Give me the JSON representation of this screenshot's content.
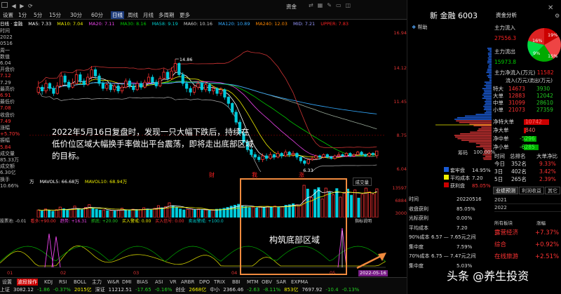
{
  "top_tabs": [
    "设置",
    "1分",
    "5分",
    "15分",
    "30分",
    "60分",
    "日线",
    "周线",
    "月线",
    "多周期",
    "更多"
  ],
  "selected_top_tab": "日线",
  "side_tool": "资金",
  "ma_line": {
    "title": "日线 · 金融",
    "ma5": "MA5: 7.33",
    "ma10": "MA10: 7.04",
    "ma20": "MA20: 7.11",
    "ma30": "MA30: 8.16",
    "ma58": "MA58: 9.19",
    "ma60": "MA60: 10.16",
    "ma120": "MA120: 10.89",
    "ma240": "MA240: 12.03",
    "mid": "MID: 7.21",
    "upper": "UPPER: 7.83"
  },
  "left_info": [
    {
      "label": "时间",
      "value": "2022"
    },
    {
      "label": "",
      "value": "0516"
    },
    {
      "label": "",
      "value": "周一"
    },
    {
      "label": "数值",
      "value": "6.04"
    },
    {
      "label": "开盘价",
      "value": "7.12"
    },
    {
      "label": "",
      "value": "7.29"
    },
    {
      "label": "最高价",
      "value": "6.91"
    },
    {
      "label": "最低价",
      "value": "7.08"
    },
    {
      "label": "收盘价",
      "value": "7.49"
    },
    {
      "label": "涨幅",
      "value": "+5.70%"
    },
    {
      "label": "振幅",
      "value": "5.84"
    },
    {
      "label": "成交量",
      "value": "85.33万"
    },
    {
      "label": "成交额",
      "value": "6.30亿"
    },
    {
      "label": "换手",
      "value": "10.66%"
    }
  ],
  "price_axis": [
    "16.94",
    "14.12",
    "11.45",
    "8.75",
    "6.04"
  ],
  "price_high_label": "14.86",
  "price_low_label": "6.33",
  "main_event_markers": [
    "财",
    "我",
    "涨"
  ],
  "annotation": "2022年5月16日复盘时，发现一只大幅下跌后，持续在低价位区域大幅换手率做出平台震荡，即将走出底部区域的目标。",
  "annotation_box2": "构筑底部区域",
  "date_arrow_label": "2022-05-16",
  "vol_header": {
    "unit": "万",
    "mavol5": "MAVOL5: 66.68万",
    "mavol10": "MAVOL10: 68.94万",
    "right_label": "成交量"
  },
  "vol_axis": [
    "13597",
    "6884",
    "3000"
  ],
  "indicator_header": [
    "股票池: -0.01",
    "看多:+90.00",
    "趋势: +16.31",
    "抓底: +20.00",
    "买入警戒: 0.00",
    "买入信号: 0.00",
    "卖出警戒: +100.0"
  ],
  "indicator_right": "指标说明",
  "x_dates": [
    "01",
    "02",
    "03",
    "04",
    "05"
  ],
  "bottom_tabs": [
    "设置",
    "波段操作",
    "KDJ",
    "RSI",
    "BOLL",
    "主力",
    "W&R",
    "DMI",
    "BIAS",
    "ASI",
    "VR",
    "ARBR",
    "DPO",
    "TRIX",
    "BBI",
    "MTM",
    "OBV",
    "SAR",
    "EXPMA"
  ],
  "selected_bottom_tab": "波段操作",
  "bottom_index": [
    "上证",
    "3082.12",
    "-1.86",
    "-0.37%",
    "2015亿",
    "深证",
    "11212.51",
    "-17.65",
    "-0.16%",
    "创业",
    "2668亿",
    "中小",
    "2366.46",
    "-2.63",
    "-8.11%",
    "853亿",
    "7697.92",
    "-10.4",
    "-0.13%"
  ],
  "right_panel": {
    "stock_title": "新",
    "stock_code": "6003",
    "stock_suffix": "金融",
    "help": "帮助",
    "fund_tab": "资金分析",
    "main_inflow_label": "主力流入",
    "main_inflow_value": "27556.3",
    "main_outflow_label": "主力流出",
    "main_outflow_value": "15973.8",
    "pie_labels": [
      "19%",
      "16%",
      "15%",
      "9%"
    ],
    "net_inflow_label": "主力净流入(万元)",
    "net_inflow_value": "11582",
    "flow_header": "流入(万元)流出(万元)",
    "flows": [
      {
        "label": "特大",
        "in": "14673",
        "out": "3930"
      },
      {
        "label": "大单",
        "in": "12883",
        "out": "12042"
      },
      {
        "label": "中单",
        "in": "31099",
        "out": "28610"
      },
      {
        "label": "小单",
        "in": "21073",
        "out": "27359"
      }
    ],
    "net": [
      {
        "label": "净特大单",
        "value": "10742"
      },
      {
        "label": "净大单",
        "value": "840"
      },
      {
        "label": "净中单",
        "value": "-5296"
      },
      {
        "label": "净小单",
        "value": "-6285"
      }
    ],
    "chip_header": "筹码",
    "chip_pct": "100.00%",
    "stats_header": [
      "时间",
      "总排名",
      "大单净比"
    ],
    "stats": [
      {
        "t": "今日",
        "rank": "352名",
        "pct": "9.33%"
      },
      {
        "t": "3日",
        "rank": "402名",
        "pct": "3.42%"
      },
      {
        "t": "5日",
        "rank": "265名",
        "pct": "2.39%"
      }
    ],
    "chip_legend": [
      {
        "label": "套牢盘",
        "value": "14.95%",
        "color": "#1a5bd6"
      },
      {
        "label": "平均成本",
        "value": "7.20",
        "color": "#ee0"
      },
      {
        "label": "获利盘",
        "value": "85.05%",
        "color": "#c00"
      }
    ],
    "f10_tabs": [
      "业绩预测",
      "利润收益",
      "其它"
    ],
    "f10_rows": [
      [
        "2021",
        ""
      ],
      [
        "2022",
        ""
      ]
    ],
    "cost_rows": [
      {
        "label": "时间",
        "value": "20220516"
      },
      {
        "label": "收盘获利",
        "value": "85.05%"
      },
      {
        "label": "光标获利",
        "value": "0.00%"
      },
      {
        "label": "平均成本",
        "value": "7.20"
      },
      {
        "label": "90%成本",
        "value": "6.57 — 7.65元之间"
      },
      {
        "label": "集中度",
        "value": "7.59%"
      },
      {
        "label": "70%成本",
        "value": "6.75 — 7.47元之间"
      },
      {
        "label": "集中度",
        "value": "5.03%"
      }
    ],
    "sector_header": [
      "所有板块",
      "涨幅"
    ],
    "sectors": [
      {
        "name": "露营经济",
        "chg": "+7.37%"
      },
      {
        "name": "综合",
        "chg": "+0.92%"
      },
      {
        "name": "在线旅游",
        "chg": "+2.51%"
      }
    ],
    "watermark": "头条 @养生投资"
  },
  "chart_data": {
    "type": "candlestick",
    "title": "",
    "y_range": [
      6.04,
      16.94
    ],
    "candles": [
      [
        12.2,
        12.6,
        13.1,
        12.0
      ],
      [
        12.6,
        12.3,
        12.8,
        12.0
      ],
      [
        12.3,
        12.9,
        13.2,
        12.1
      ],
      [
        12.9,
        12.5,
        13.0,
        12.3
      ],
      [
        12.5,
        12.1,
        12.7,
        11.9
      ],
      [
        12.1,
        12.7,
        13.0,
        12.0
      ],
      [
        12.7,
        13.5,
        13.8,
        12.6
      ],
      [
        13.5,
        13.0,
        13.7,
        12.8
      ],
      [
        13.0,
        12.6,
        13.2,
        12.4
      ],
      [
        12.6,
        12.9,
        13.3,
        12.5
      ],
      [
        12.9,
        13.6,
        14.0,
        12.8
      ],
      [
        13.6,
        13.1,
        13.8,
        12.9
      ],
      [
        13.1,
        12.8,
        13.3,
        12.6
      ],
      [
        12.8,
        13.4,
        13.7,
        12.7
      ],
      [
        13.4,
        14.0,
        14.3,
        13.2
      ],
      [
        14.0,
        13.5,
        14.2,
        13.3
      ],
      [
        13.5,
        12.9,
        13.7,
        12.7
      ],
      [
        12.9,
        12.5,
        13.1,
        12.3
      ],
      [
        12.5,
        12.8,
        13.0,
        12.3
      ],
      [
        12.8,
        12.4,
        13.0,
        12.2
      ],
      [
        12.4,
        12.7,
        12.9,
        12.2
      ],
      [
        12.7,
        12.3,
        12.9,
        12.1
      ],
      [
        12.3,
        12.6,
        12.8,
        12.1
      ],
      [
        12.6,
        13.1,
        13.3,
        12.5
      ],
      [
        13.1,
        12.7,
        13.3,
        12.5
      ],
      [
        12.7,
        12.4,
        12.9,
        12.2
      ],
      [
        12.4,
        12.9,
        13.1,
        12.3
      ],
      [
        12.9,
        12.6,
        13.1,
        12.4
      ],
      [
        12.6,
        13.0,
        13.2,
        12.5
      ],
      [
        13.0,
        13.4,
        13.7,
        12.9
      ],
      [
        13.4,
        13.0,
        13.6,
        12.8
      ],
      [
        13.0,
        12.7,
        13.2,
        12.5
      ],
      [
        12.7,
        13.3,
        13.5,
        12.6
      ],
      [
        13.3,
        13.8,
        14.1,
        13.2
      ],
      [
        13.8,
        13.3,
        14.0,
        13.1
      ],
      [
        13.3,
        13.9,
        14.2,
        13.2
      ],
      [
        13.9,
        14.5,
        14.86,
        13.8
      ],
      [
        14.5,
        13.6,
        14.6,
        13.4
      ],
      [
        13.6,
        12.9,
        13.8,
        12.7
      ],
      [
        12.9,
        12.5,
        13.1,
        12.2
      ],
      [
        12.5,
        12.2,
        12.7,
        11.9
      ],
      [
        12.2,
        12.6,
        12.8,
        12.0
      ],
      [
        12.6,
        12.9,
        13.1,
        12.4
      ],
      [
        12.9,
        12.4,
        13.0,
        12.2
      ],
      [
        12.4,
        12.8,
        13.0,
        12.2
      ],
      [
        12.8,
        12.3,
        12.9,
        12.1
      ],
      [
        12.3,
        12.5,
        12.7,
        12.0
      ],
      [
        12.5,
        12.1,
        12.6,
        11.9
      ],
      [
        12.1,
        12.4,
        12.6,
        11.9
      ],
      [
        12.4,
        11.8,
        12.5,
        11.6
      ],
      [
        11.8,
        11.3,
        11.9,
        11.0
      ],
      [
        11.3,
        10.6,
        11.4,
        10.4
      ],
      [
        10.6,
        9.8,
        10.8,
        9.6
      ],
      [
        9.8,
        8.9,
        10.0,
        8.7
      ],
      [
        8.9,
        8.2,
        9.1,
        8.0
      ],
      [
        8.2,
        7.6,
        8.4,
        7.4
      ],
      [
        7.6,
        7.2,
        7.8,
        7.0
      ],
      [
        7.2,
        7.0,
        7.4,
        6.8
      ],
      [
        7.0,
        6.8,
        7.2,
        6.6
      ],
      [
        6.8,
        7.1,
        7.3,
        6.6
      ],
      [
        7.1,
        6.9,
        7.3,
        6.7
      ],
      [
        6.9,
        7.2,
        7.4,
        6.8
      ],
      [
        7.2,
        7.0,
        7.3,
        6.8
      ],
      [
        7.0,
        7.3,
        7.5,
        6.9
      ],
      [
        7.3,
        7.1,
        7.4,
        6.9
      ],
      [
        7.1,
        7.4,
        7.6,
        7.0
      ],
      [
        7.4,
        7.2,
        7.5,
        7.0
      ],
      [
        7.2,
        7.3,
        7.5,
        7.0
      ],
      [
        7.3,
        7.0,
        7.4,
        6.8
      ],
      [
        7.0,
        6.7,
        7.1,
        6.5
      ],
      [
        6.7,
        6.5,
        6.8,
        6.33
      ],
      [
        6.5,
        6.8,
        6.9,
        6.4
      ],
      [
        6.8,
        6.9,
        7.1,
        6.7
      ],
      [
        6.9,
        7.1,
        7.2,
        6.8
      ],
      [
        7.1,
        7.0,
        7.2,
        6.8
      ],
      [
        7.0,
        7.2,
        7.3,
        6.9
      ],
      [
        7.2,
        7.0,
        7.3,
        6.9
      ],
      [
        7.0,
        6.9,
        7.1,
        6.8
      ],
      [
        6.9,
        7.1,
        7.2,
        6.8
      ],
      [
        7.1,
        7.2,
        7.4,
        7.0
      ],
      [
        7.2,
        7.1,
        7.3,
        7.0
      ],
      [
        7.1,
        7.3,
        7.4,
        7.0
      ],
      [
        7.3,
        7.1,
        7.4,
        7.0
      ],
      [
        7.1,
        7.2,
        7.3,
        7.0
      ],
      [
        7.2,
        7.4,
        7.5,
        7.1
      ],
      [
        7.4,
        7.2,
        7.5,
        7.1
      ],
      [
        7.2,
        7.1,
        7.3,
        7.0
      ],
      [
        7.1,
        7.3,
        7.4,
        7.0
      ],
      [
        7.3,
        7.2,
        7.4,
        7.1
      ],
      [
        7.12,
        7.49,
        7.49,
        6.91
      ]
    ],
    "volumes": [
      3200,
      2800,
      3600,
      3000,
      2600,
      3300,
      4400,
      3700,
      3100,
      3400,
      4800,
      3800,
      3300,
      4300,
      5400,
      4200,
      3500,
      3100,
      3200,
      2900,
      3000,
      2800,
      3100,
      3900,
      3300,
      3000,
      3500,
      3200,
      3400,
      4100,
      3600,
      3200,
      3900,
      5000,
      4100,
      4600,
      6200,
      5000,
      4200,
      3600,
      3200,
      3400,
      3700,
      3200,
      3500,
      3100,
      3200,
      2900,
      3100,
      3500,
      3600,
      3900,
      4300,
      4800,
      5200,
      5600,
      5000,
      4600,
      4200,
      4400,
      4100,
      4600,
      4300,
      4700,
      4400,
      4800,
      4500,
      4600,
      5200,
      5400,
      5800,
      5400,
      5000,
      13597,
      12000,
      8400,
      11800,
      12600,
      7800,
      12400,
      10600,
      9600,
      12200,
      8600,
      10600,
      12000,
      9400,
      11600,
      8200,
      9800,
      12400,
      10800,
      9800,
      12100
    ]
  }
}
